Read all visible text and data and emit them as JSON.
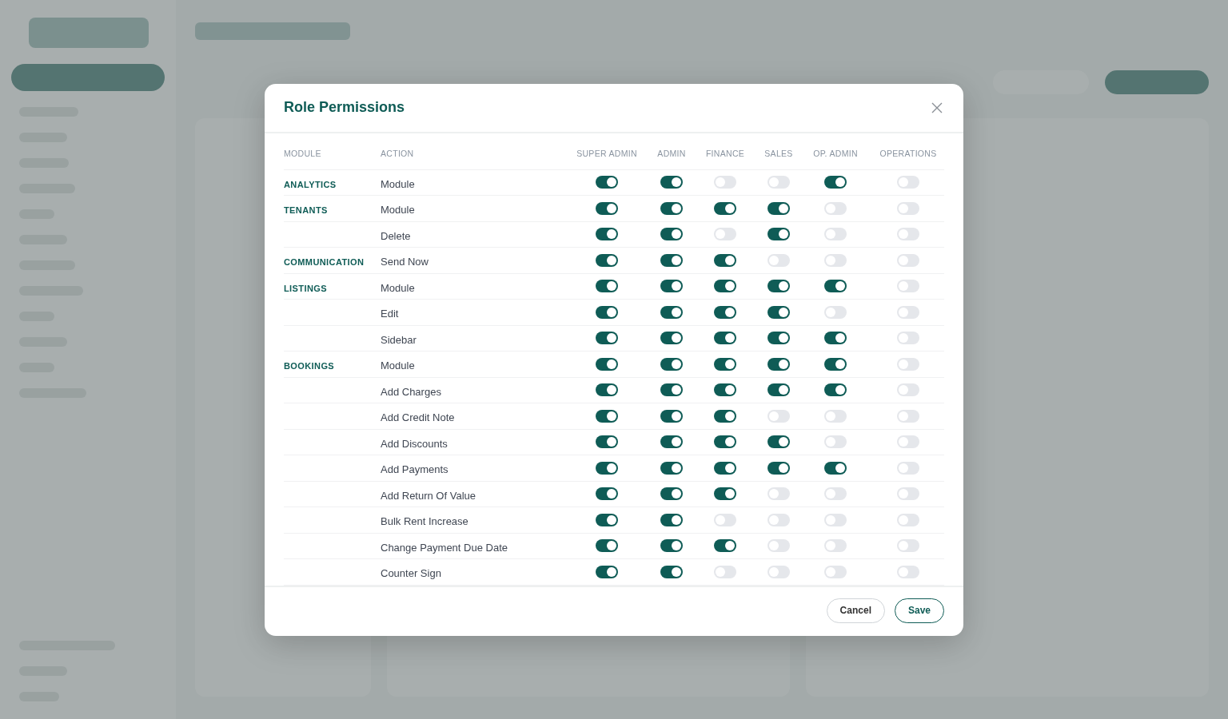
{
  "dialog": {
    "title": "Role Permissions",
    "columns": [
      "MODULE",
      "ACTION",
      "SUPER ADMIN",
      "ADMIN",
      "FINANCE",
      "SALES",
      "OP. ADMIN",
      "OPERATIONS"
    ],
    "modules": [
      {
        "name": "ANALYTICS",
        "actions": [
          {
            "name": "Module",
            "toggles": [
              {
                "on": true
              },
              {
                "on": true
              },
              {
                "on": false
              },
              {
                "on": false
              },
              {
                "on": true
              },
              {
                "on": false
              }
            ]
          }
        ]
      },
      {
        "name": "TENANTS",
        "actions": [
          {
            "name": "Module",
            "toggles": [
              {
                "on": true
              },
              {
                "on": true
              },
              {
                "on": true
              },
              {
                "on": true
              },
              {
                "on": false
              },
              {
                "on": false
              }
            ]
          },
          {
            "name": "Delete",
            "toggles": [
              {
                "on": true
              },
              {
                "on": true
              },
              {
                "on": false
              },
              {
                "on": true
              },
              {
                "on": false
              },
              {
                "on": false
              }
            ]
          }
        ]
      },
      {
        "name": "COMMUNICATION",
        "actions": [
          {
            "name": "Send Now",
            "toggles": [
              {
                "on": true
              },
              {
                "on": true
              },
              {
                "on": true
              },
              {
                "on": false
              },
              {
                "on": false
              },
              {
                "on": false
              }
            ]
          }
        ]
      },
      {
        "name": "LISTINGS",
        "actions": [
          {
            "name": "Module",
            "toggles": [
              {
                "on": true
              },
              {
                "on": true
              },
              {
                "on": true
              },
              {
                "on": true
              },
              {
                "on": true
              },
              {
                "on": false
              }
            ]
          },
          {
            "name": "Edit",
            "toggles": [
              {
                "on": true
              },
              {
                "on": true
              },
              {
                "on": true
              },
              {
                "on": true
              },
              {
                "on": false
              },
              {
                "on": false
              }
            ]
          },
          {
            "name": "Sidebar",
            "toggles": [
              {
                "on": true
              },
              {
                "on": true
              },
              {
                "on": true
              },
              {
                "on": true
              },
              {
                "on": true
              },
              {
                "on": false
              }
            ]
          }
        ]
      },
      {
        "name": "BOOKINGS",
        "actions": [
          {
            "name": "Module",
            "toggles": [
              {
                "on": true
              },
              {
                "on": true
              },
              {
                "on": true
              },
              {
                "on": true
              },
              {
                "on": true
              },
              {
                "on": false
              }
            ]
          },
          {
            "name": "Add Charges",
            "toggles": [
              {
                "on": true
              },
              {
                "on": true
              },
              {
                "on": true
              },
              {
                "on": true
              },
              {
                "on": true
              },
              {
                "on": false
              }
            ]
          },
          {
            "name": "Add Credit Note",
            "toggles": [
              {
                "on": true
              },
              {
                "on": true
              },
              {
                "on": true
              },
              {
                "on": false
              },
              {
                "on": false
              },
              {
                "on": false
              }
            ]
          },
          {
            "name": "Add Discounts",
            "toggles": [
              {
                "on": true
              },
              {
                "on": true
              },
              {
                "on": true
              },
              {
                "on": true
              },
              {
                "on": false
              },
              {
                "on": false
              }
            ]
          },
          {
            "name": "Add Payments",
            "toggles": [
              {
                "on": true
              },
              {
                "on": true
              },
              {
                "on": true
              },
              {
                "on": true
              },
              {
                "on": true
              },
              {
                "on": false
              }
            ]
          },
          {
            "name": "Add Return Of Value",
            "toggles": [
              {
                "on": true
              },
              {
                "on": true
              },
              {
                "on": true
              },
              {
                "on": false
              },
              {
                "on": false
              },
              {
                "on": false
              }
            ]
          },
          {
            "name": "Bulk Rent Increase",
            "toggles": [
              {
                "on": true
              },
              {
                "on": true
              },
              {
                "on": false
              },
              {
                "on": false
              },
              {
                "on": false
              },
              {
                "on": false
              }
            ]
          },
          {
            "name": "Change Payment Due Date",
            "toggles": [
              {
                "on": true
              },
              {
                "on": true
              },
              {
                "on": true
              },
              {
                "on": false
              },
              {
                "on": false
              },
              {
                "on": false
              }
            ]
          },
          {
            "name": "Counter Sign",
            "toggles": [
              {
                "on": true
              },
              {
                "on": true
              },
              {
                "on": false
              },
              {
                "on": false
              },
              {
                "on": false
              },
              {
                "on": false
              }
            ]
          }
        ]
      }
    ],
    "buttons": [
      {
        "label": "Cancel",
        "kind": "cancel"
      },
      {
        "label": "Save",
        "kind": "save"
      }
    ]
  }
}
